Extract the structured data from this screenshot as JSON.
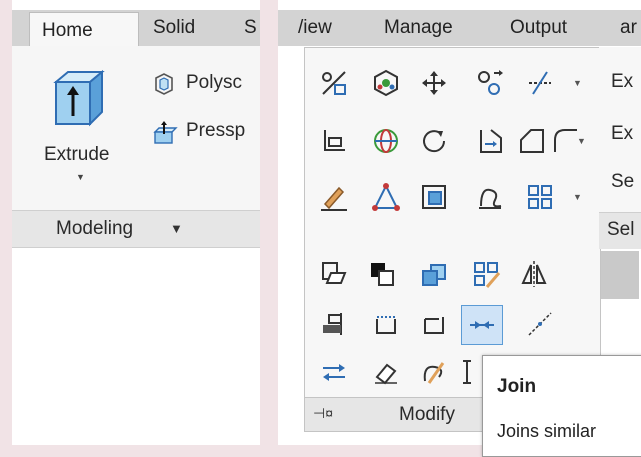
{
  "left": {
    "tabs": [
      "Home",
      "Solid",
      "S"
    ],
    "extrude_label": "Extrude",
    "polysolid_label": "Polysc",
    "presspull_label": "Pressp",
    "panel_title": "Modeling",
    "panel_arrow": "▼"
  },
  "right": {
    "tabs": [
      "/iew",
      "Manage",
      "Output",
      "ar"
    ],
    "side_items": [
      "Ex",
      "Ex",
      "Se"
    ],
    "side_panel_title": "Sel",
    "panel_title": "Modify",
    "pin_glyph": "⊣¤"
  },
  "tooltip": {
    "title": "Join",
    "description": "Joins similar"
  },
  "colors": {
    "background": "#f1e3e6",
    "tab_bar": "#d3d3d3",
    "panel_title_bar": "#e6e6e6",
    "highlight": "#cfe3f7",
    "icon_blue": "#2f6db3",
    "icon_green": "#3a9a3a",
    "icon_red": "#c33a3a"
  }
}
